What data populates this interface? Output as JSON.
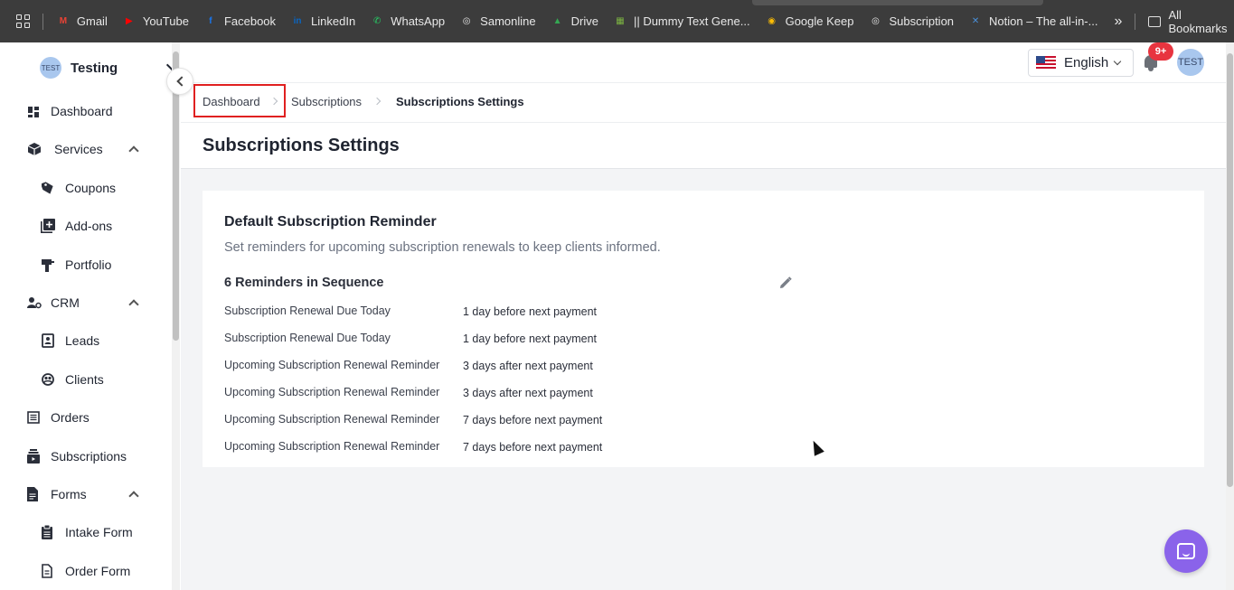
{
  "bookmarks": {
    "items": [
      {
        "label": "Gmail",
        "color": "#ea4335",
        "glyph": "M"
      },
      {
        "label": "YouTube",
        "color": "#ff0000",
        "glyph": "▶"
      },
      {
        "label": "Facebook",
        "color": "#1877f2",
        "glyph": "f"
      },
      {
        "label": "LinkedIn",
        "color": "#0a66c2",
        "glyph": "in"
      },
      {
        "label": "WhatsApp",
        "color": "#25d366",
        "glyph": "✆"
      },
      {
        "label": "Samonline",
        "color": "#e8e8e8",
        "glyph": "◎"
      },
      {
        "label": "Drive",
        "color": "#34a853",
        "glyph": "▲"
      },
      {
        "label": "|| Dummy Text Gene...",
        "color": "#7cb342",
        "glyph": "▦"
      },
      {
        "label": "Google Keep",
        "color": "#fbbc04",
        "glyph": "◉"
      },
      {
        "label": "Subscription",
        "color": "#e8e8e8",
        "glyph": "◎"
      },
      {
        "label": "Notion – The all-in-...",
        "color": "#4a90d9",
        "glyph": "✕"
      }
    ],
    "all_label": "All Bookmarks",
    "more_glyph": "»"
  },
  "sidebar": {
    "workspace_avatar": "TEST",
    "workspace_name": "Testing",
    "items": [
      {
        "label": "Dashboard"
      },
      {
        "label": "Services"
      },
      {
        "label": "Coupons"
      },
      {
        "label": "Add-ons"
      },
      {
        "label": "Portfolio"
      },
      {
        "label": "CRM"
      },
      {
        "label": "Leads"
      },
      {
        "label": "Clients"
      },
      {
        "label": "Orders"
      },
      {
        "label": "Subscriptions"
      },
      {
        "label": "Forms"
      },
      {
        "label": "Intake Form"
      },
      {
        "label": "Order Form"
      }
    ]
  },
  "header": {
    "language": "English",
    "notifications_badge": "9+",
    "user_avatar": "TEST"
  },
  "breadcrumb": {
    "items": [
      "Dashboard",
      "Subscriptions",
      "Subscriptions Settings"
    ]
  },
  "page": {
    "title": "Subscriptions Settings"
  },
  "reminder_card": {
    "title": "Default Subscription Reminder",
    "subtitle": "Set reminders for upcoming subscription renewals to keep clients informed.",
    "sequence_title": "6 Reminders in Sequence",
    "reminders": [
      {
        "name": "Subscription Renewal Due Today",
        "timing": "1 day before next payment"
      },
      {
        "name": "Subscription Renewal Due Today",
        "timing": "1 day before next payment"
      },
      {
        "name": "Upcoming Subscription Renewal Reminder",
        "timing": "3 days after next payment"
      },
      {
        "name": "Upcoming Subscription Renewal Reminder",
        "timing": "3 days after next payment"
      },
      {
        "name": "Upcoming Subscription Renewal Reminder",
        "timing": "7 days before next payment"
      },
      {
        "name": "Upcoming Subscription Renewal Reminder",
        "timing": "7 days before next payment"
      }
    ]
  }
}
